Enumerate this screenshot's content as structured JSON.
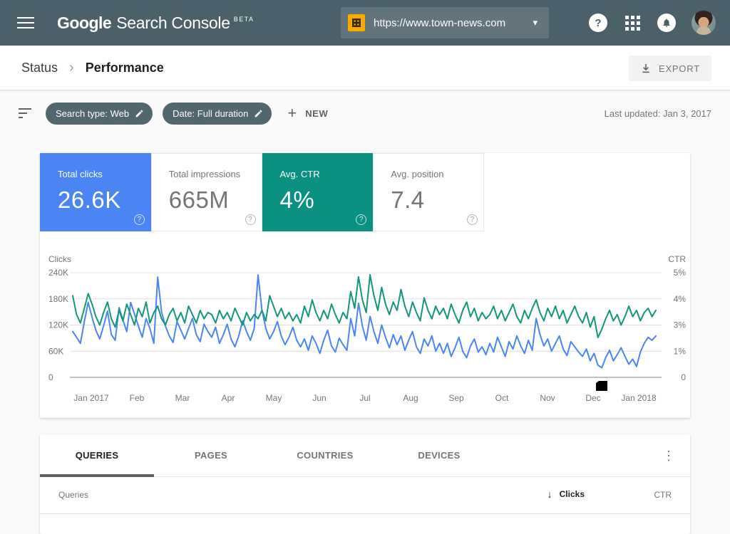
{
  "app_bar": {
    "logo": {
      "part1": "Google",
      "part2": "Search Console",
      "beta": "BETA"
    },
    "property_selector": {
      "value": "https://www.town-news.com",
      "caret_glyph": "▾"
    },
    "help_glyph": "?"
  },
  "breadcrumb": {
    "section": "Status",
    "separator_glyph": "›",
    "page": "Performance"
  },
  "export": {
    "label": "EXPORT"
  },
  "filter_bar": {
    "chips": [
      {
        "label": "Search type: Web"
      },
      {
        "label": "Date: Full duration"
      }
    ],
    "new_button": {
      "plus_glyph": "+",
      "label": "NEW"
    },
    "last_updated": "Last updated: Jan 3, 2017"
  },
  "metrics": {
    "help_glyph": "?",
    "cards": [
      {
        "label": "Total clicks",
        "value": "26.6K",
        "selected": true,
        "color": "#4b85f4"
      },
      {
        "label": "Total impressions",
        "value": "665M",
        "selected": false
      },
      {
        "label": "Avg. CTR",
        "value": "4%",
        "selected": true,
        "color": "#0a9182"
      },
      {
        "label": "Avg. position",
        "value": "7.4",
        "selected": false
      }
    ]
  },
  "chart_data": {
    "type": "line",
    "grid": true,
    "left_axis": {
      "label": "Clicks",
      "ticks": [
        "240K",
        "180K",
        "120K",
        "60K",
        "0"
      ],
      "max": 240,
      "unit": "thousands"
    },
    "right_axis": {
      "label": "CTR",
      "ticks": [
        "5%",
        "4%",
        "3%",
        "1%",
        "0"
      ],
      "max": 5,
      "unit": "percent"
    },
    "x_ticks": [
      "Jan 2017",
      "Feb",
      "Mar",
      "Apr",
      "May",
      "Jun",
      "Jul",
      "Aug",
      "Sep",
      "Oct",
      "Nov",
      "Dec",
      "Jan 2018"
    ],
    "series": [
      {
        "name": "Clicks",
        "axis": "left",
        "color": "#4b85f4",
        "values": [
          105,
          92,
          78,
          128,
          172,
          138,
          108,
          88,
          118,
          152,
          98,
          85,
          160,
          132,
          105,
          172,
          145,
          118,
          92,
          135,
          112,
          78,
          230,
          150,
          118,
          95,
          80,
          128,
          108,
          88,
          112,
          135,
          98,
          82,
          122,
          105,
          92,
          115,
          78,
          98,
          122,
          88,
          70,
          95,
          130,
          105,
          85,
          112,
          235,
          155,
          112,
          88,
          105,
          128,
          95,
          75,
          92,
          115,
          85,
          70,
          88,
          62,
          95,
          78,
          55,
          85,
          108,
          72,
          58,
          90,
          75,
          62,
          135,
          95,
          170,
          118,
          85,
          140,
          105,
          78,
          120,
          92,
          68,
          98,
          75,
          95,
          62,
          85,
          105,
          70,
          55,
          88,
          72,
          95,
          60,
          78,
          55,
          78,
          48,
          68,
          92,
          60,
          45,
          72,
          88,
          58,
          70,
          52,
          78,
          58,
          92,
          70,
          48,
          82,
          65,
          95,
          72,
          55,
          85,
          62,
          135,
          98,
          72,
          88,
          60,
          78,
          95,
          65,
          50,
          82,
          70,
          58,
          48,
          65,
          38,
          55,
          28,
          22,
          45,
          62,
          38,
          52,
          68,
          48,
          30,
          42,
          25,
          58,
          78,
          92,
          85,
          95
        ]
      },
      {
        "name": "CTR",
        "axis": "right",
        "color": "#13977c",
        "values": [
          3.9,
          3.0,
          2.6,
          3.3,
          4.0,
          3.5,
          2.9,
          2.5,
          3.1,
          3.6,
          2.8,
          2.4,
          3.2,
          2.7,
          3.5,
          3.0,
          2.5,
          3.3,
          2.9,
          3.6,
          2.6,
          3.1,
          3.4,
          2.8,
          2.5,
          3.0,
          3.3,
          2.7,
          3.1,
          2.6,
          3.4,
          3.0,
          2.6,
          3.2,
          2.8,
          3.1,
          3.0,
          2.6,
          3.2,
          2.8,
          3.1,
          2.7,
          3.3,
          2.9,
          2.5,
          3.1,
          2.7,
          3.0,
          2.8,
          3.2,
          2.7,
          3.9,
          3.4,
          2.9,
          3.3,
          2.8,
          3.1,
          2.7,
          3.0,
          2.6,
          3.4,
          2.9,
          3.7,
          3.1,
          2.7,
          3.2,
          2.8,
          3.5,
          3.0,
          2.6,
          3.1,
          2.8,
          4.1,
          3.3,
          4.8,
          3.7,
          3.1,
          4.9,
          3.9,
          3.2,
          4.3,
          3.5,
          3.0,
          3.6,
          3.2,
          4.2,
          3.4,
          2.9,
          3.6,
          3.1,
          2.7,
          3.8,
          3.2,
          2.8,
          3.4,
          3.0,
          3.3,
          2.8,
          3.5,
          3.0,
          2.6,
          3.2,
          3.6,
          2.9,
          3.3,
          2.7,
          3.1,
          2.8,
          3.0,
          3.4,
          2.8,
          3.2,
          2.7,
          3.1,
          3.5,
          2.9,
          2.6,
          3.2,
          2.8,
          3.3,
          3.7,
          3.1,
          2.7,
          3.3,
          2.9,
          3.4,
          2.8,
          3.2,
          2.6,
          3.0,
          3.4,
          2.9,
          2.6,
          3.1,
          2.4,
          2.9,
          1.9,
          2.3,
          2.8,
          3.2,
          2.7,
          3.0,
          2.5,
          2.9,
          3.4,
          2.9,
          3.2,
          2.7,
          3.1,
          3.3,
          2.9,
          3.2
        ]
      }
    ],
    "colors": {
      "gridline": "#e0e0e0",
      "baseline": "#80868b"
    }
  },
  "tabs": {
    "items": [
      {
        "label": "QUERIES"
      },
      {
        "label": "PAGES"
      },
      {
        "label": "COUNTRIES"
      },
      {
        "label": "DEVICES"
      }
    ],
    "active": "QUERIES",
    "menu_glyph": "⋮"
  },
  "table": {
    "header": {
      "queries": "Queries",
      "sort_glyph": "↓",
      "clicks": "Clicks",
      "ctr": "CTR"
    }
  }
}
